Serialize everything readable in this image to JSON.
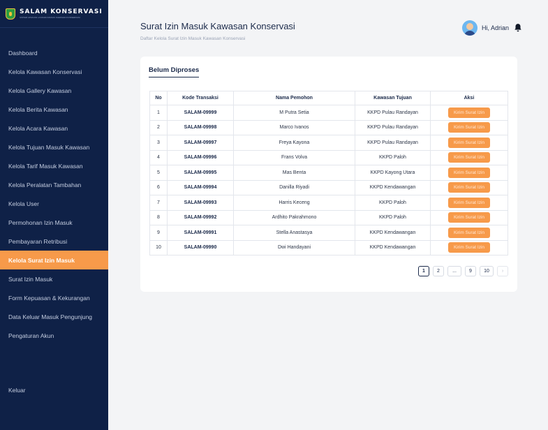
{
  "brand": {
    "name": "SALAM KONSERVASI",
    "tagline": "SISTEM APLIKASI LAYANAN MASUK KAWASAN KONSERVASI",
    "logo_color": "#2e9e3f"
  },
  "sidebar": {
    "items": [
      {
        "label": "Dashboard",
        "active": false
      },
      {
        "label": "Kelola Kawasan Konservasi",
        "active": false
      },
      {
        "label": "Kelola Gallery Kawasan",
        "active": false
      },
      {
        "label": "Kelola Berita Kawasan",
        "active": false
      },
      {
        "label": "Kelola Acara Kawasan",
        "active": false
      },
      {
        "label": "Kelola Tujuan Masuk Kawasan",
        "active": false
      },
      {
        "label": "Kelola Tarif Masuk Kawasan",
        "active": false
      },
      {
        "label": "Kelola Peralatan Tambahan",
        "active": false
      },
      {
        "label": "Kelola User",
        "active": false
      },
      {
        "label": "Permohonan Izin Masuk",
        "active": false
      },
      {
        "label": "Pembayaran Retribusi",
        "active": false
      },
      {
        "label": "Kelola Surat Izin Masuk",
        "active": true
      },
      {
        "label": "Surat Izin Masuk",
        "active": false
      },
      {
        "label": "Form Kepuasan & Kekurangan",
        "active": false
      },
      {
        "label": "Data Keluar Masuk Pengunjung",
        "active": false
      },
      {
        "label": "Pengaturan Akun",
        "active": false
      }
    ],
    "logout_label": "Keluar",
    "bg_color": "#0f2147",
    "active_color": "#f79a4a"
  },
  "header": {
    "title": "Surat Izin Masuk Kawasan Konservasi",
    "subtitle": "Daftar Kelola Surat Izin Masuk Kawasan Konservasi",
    "greeting": "Hi, Adrian",
    "avatar_icon": "user-avatar",
    "bell_icon": "bell-icon"
  },
  "card": {
    "tab_label": "Belum Diproses"
  },
  "table": {
    "headers": [
      "No",
      "Kode Transaksi",
      "Nama Pemohon",
      "Kawasan Tujuan",
      "Aksi"
    ],
    "rows": [
      {
        "no": "1",
        "code": "SALAM-09999",
        "name": "M Putra Setia",
        "area": "KKPD Pulau Randayan",
        "action": "Kirim Surat Izin"
      },
      {
        "no": "2",
        "code": "SALAM-09998",
        "name": "Marco Ivanos",
        "area": "KKPD Pulau Randayan",
        "action": "Kirim Surat Izin"
      },
      {
        "no": "3",
        "code": "SALAM-09997",
        "name": "Freya Kayona",
        "area": "KKPD Pulau Randayan",
        "action": "Kirim Surat Izin"
      },
      {
        "no": "4",
        "code": "SALAM-09996",
        "name": "Frans Volva",
        "area": "KKPD Paloh",
        "action": "Kirim Surat Izin"
      },
      {
        "no": "5",
        "code": "SALAM-09995",
        "name": "Mas Benta",
        "area": "KKPD Kayong Utara",
        "action": "Kirim Surat Izin"
      },
      {
        "no": "6",
        "code": "SALAM-09994",
        "name": "Danilla Riyadi",
        "area": "KKPD Kendawangan",
        "action": "Kirim Surat Izin"
      },
      {
        "no": "7",
        "code": "SALAM-09993",
        "name": "Harris Keceng",
        "area": "KKPD Paloh",
        "action": "Kirim Surat Izin"
      },
      {
        "no": "8",
        "code": "SALAM-09992",
        "name": "Ardhito Pakrahmono",
        "area": "KKPD Paloh",
        "action": "Kirim Surat Izin"
      },
      {
        "no": "9",
        "code": "SALAM-09991",
        "name": "Stella Anastasya",
        "area": "KKPD Kendawangan",
        "action": "Kirim Surat Izin"
      },
      {
        "no": "10",
        "code": "SALAM-09990",
        "name": "Dwi Handayani",
        "area": "KKPD Kendawangan",
        "action": "Kirim Surat Izin"
      }
    ],
    "button_color": "#f79a4a"
  },
  "pagination": {
    "pages": [
      "1",
      "2",
      "...",
      "9",
      "10"
    ],
    "current": "1",
    "next_icon": "chevron-right-icon"
  }
}
